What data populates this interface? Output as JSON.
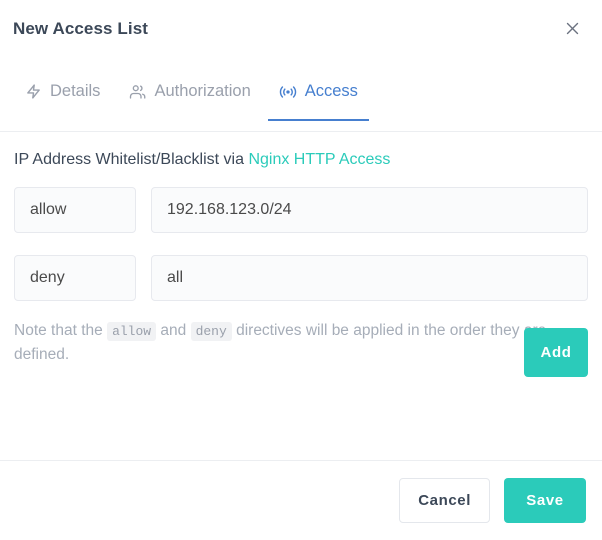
{
  "window": {
    "title": "New Access List",
    "close_icon": "close-icon"
  },
  "tabs": [
    {
      "label": "Details",
      "icon": "bolt-icon",
      "active": false
    },
    {
      "label": "Authorization",
      "icon": "users-icon",
      "active": false
    },
    {
      "label": "Access",
      "icon": "broadcast-icon",
      "active": true
    }
  ],
  "body": {
    "description_prefix": "IP Address Whitelist/Blacklist via ",
    "description_link": "Nginx HTTP Access",
    "rules": [
      {
        "directive": "allow",
        "value": "192.168.123.0/24",
        "value_placeholder": ""
      },
      {
        "directive": "deny",
        "value": "all",
        "value_placeholder": ""
      }
    ],
    "directive_options": [
      "allow",
      "deny"
    ],
    "note": {
      "part1": "Note that the ",
      "code1": "allow",
      "part2": " and ",
      "code2": "deny",
      "part3": " directives will be applied in the order they are defined."
    },
    "add_label": "Add"
  },
  "footer": {
    "cancel_label": "Cancel",
    "save_label": "Save"
  },
  "colors": {
    "accent_teal": "#2bcbba",
    "accent_blue": "#467fcf",
    "text_dark": "#3c4858",
    "text_muted": "#9aa0ac"
  }
}
